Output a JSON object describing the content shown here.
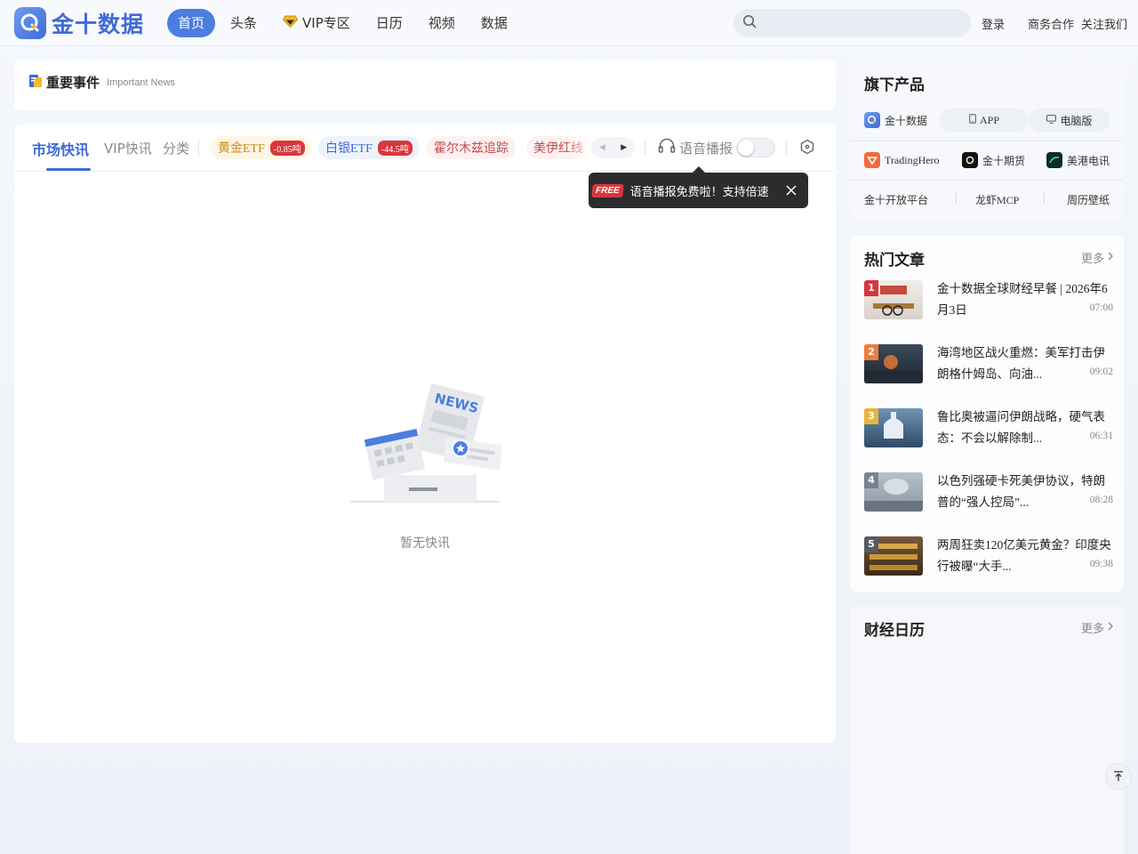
{
  "header": {
    "logo_text": "金十数据",
    "nav": [
      "首页",
      "头条",
      "VIP专区",
      "日历",
      "视频",
      "数据"
    ],
    "search_placeholder": "",
    "login": "登录",
    "business": "商务合作",
    "follow": "关注我们"
  },
  "important": {
    "title": "重要事件",
    "subtitle": "Important News"
  },
  "feed": {
    "tabs": [
      "市场快讯",
      "VIP快讯",
      "分类"
    ],
    "chips": [
      {
        "label": "黄金ETF",
        "badge": "-0.85吨"
      },
      {
        "label": "白银ETF",
        "badge": "-44.5吨"
      },
      {
        "label": "霍尔木兹追踪",
        "badge": ""
      },
      {
        "label": "美伊红线",
        "badge": ""
      }
    ],
    "voice_label": "语音播报",
    "tooltip_badge": "FREE",
    "tooltip_text": "语音播报免费啦！支持倍速",
    "empty_text": "暂无快讯"
  },
  "products": {
    "title": "旗下产品",
    "main": "金十数据",
    "app": "APP",
    "pc": "电脑版",
    "row2": [
      "TradingHero",
      "金十期货",
      "美港电讯"
    ],
    "row3": [
      "金十开放平台",
      "龙虾MCP",
      "周历壁纸"
    ]
  },
  "hot": {
    "title": "热门文章",
    "more": "更多",
    "articles": [
      {
        "rank": "1",
        "title": "金十数据全球财经早餐 | 2026年6月3日",
        "time": "07:00"
      },
      {
        "rank": "2",
        "title": "海湾地区战火重燃：美军打击伊朗格什姆岛、向油...",
        "time": "09:02"
      },
      {
        "rank": "3",
        "title": "鲁比奥被逼问伊朗战略，硬气表态：不会以解除制...",
        "time": "06:31"
      },
      {
        "rank": "4",
        "title": "以色列强硬卡死美伊协议，特朗普的“强人控局”...",
        "time": "08:28"
      },
      {
        "rank": "5",
        "title": "两周狂卖120亿美元黄金？印度央行被曝“大手...",
        "time": "09:38"
      }
    ]
  },
  "calendar": {
    "title": "财经日历",
    "more": "更多"
  },
  "colors": {
    "accent": "#3f6ad8",
    "badge_red": "#d9363e",
    "gold": "#c58d14"
  }
}
